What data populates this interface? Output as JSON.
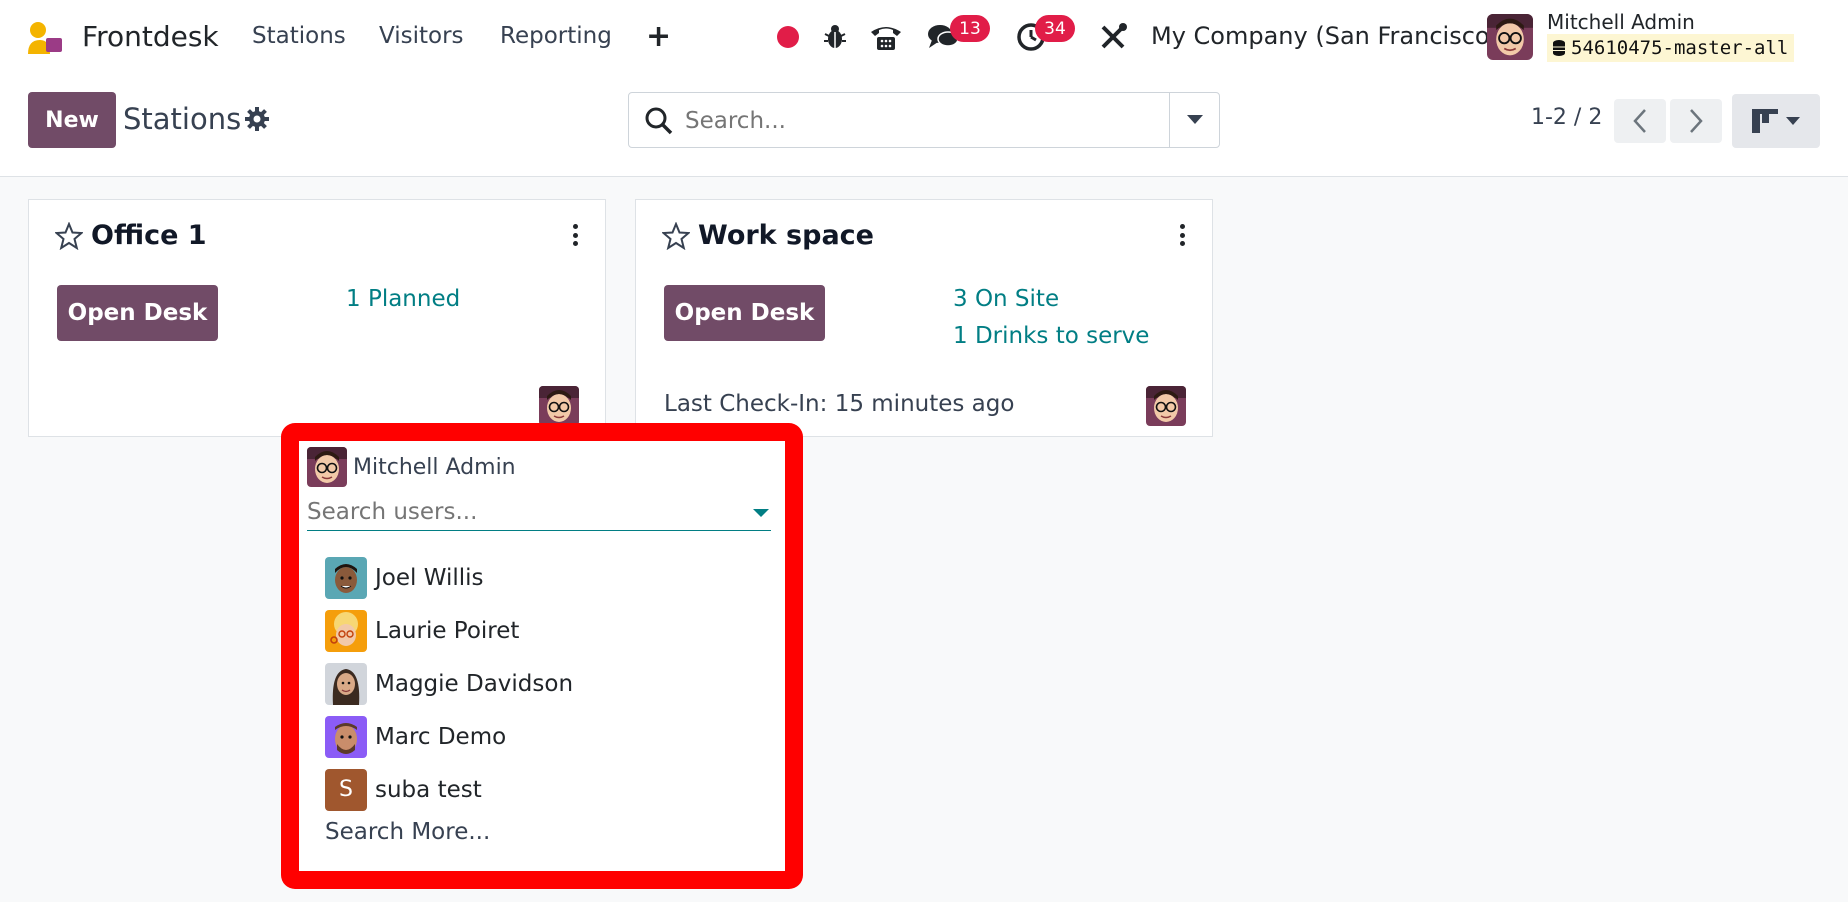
{
  "navbar": {
    "app_name": "Frontdesk",
    "menu": [
      "Stations",
      "Visitors",
      "Reporting"
    ],
    "plus_label": "+",
    "messages_count": "13",
    "activities_count": "34",
    "company": "My Company (San Francisco)",
    "user_name": "Mitchell Admin",
    "database": "54610475-master-all"
  },
  "control": {
    "new_label": "New",
    "breadcrumb": "Stations",
    "search_placeholder": "Search...",
    "pager": "1-2 / 2"
  },
  "cards": [
    {
      "title": "Office 1",
      "open_label": "Open Desk",
      "stats": [
        "1 Planned"
      ],
      "last_checkin": ""
    },
    {
      "title": "Work space",
      "open_label": "Open Desk",
      "stats": [
        "3 On Site",
        "1 Drinks to serve"
      ],
      "last_checkin": "Last Check-In: 15 minutes ago"
    }
  ],
  "popover": {
    "current_assignee": "Mitchell Admin",
    "search_placeholder": "Search users...",
    "users": [
      "Joel Willis",
      "Laurie Poiret",
      "Maggie Davidson",
      "Marc Demo",
      "suba test"
    ],
    "suba_initial": "S",
    "search_more": "Search More..."
  },
  "colors": {
    "brand": "#714b67",
    "link": "#017e84",
    "badge": "#e11d48",
    "highlight": "#ff0000"
  }
}
